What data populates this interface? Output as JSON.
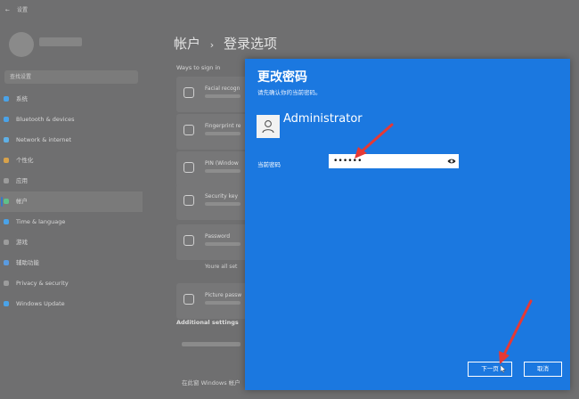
{
  "settings": {
    "topbar": {
      "back": "←",
      "title": "设置"
    },
    "search_placeholder": "查找设置",
    "nav": [
      {
        "label": "系统",
        "color": "#4aa3e8"
      },
      {
        "label": "Bluetooth & devices",
        "color": "#4aa3e8"
      },
      {
        "label": "Network & internet",
        "color": "#5fb0e6"
      },
      {
        "label": "个性化",
        "color": "#d8a24a"
      },
      {
        "label": "应用",
        "color": "#9c9c9c"
      },
      {
        "label": "帐户",
        "color": "#5fc08a"
      },
      {
        "label": "Time & language",
        "color": "#4aa3e8"
      },
      {
        "label": "游戏",
        "color": "#9c9c9c"
      },
      {
        "label": "辅助功能",
        "color": "#5a9be0"
      },
      {
        "label": "Privacy & security",
        "color": "#9c9c9c"
      },
      {
        "label": "Windows Update",
        "color": "#4aa3e8"
      }
    ],
    "active_nav_index": 5,
    "breadcrumb": {
      "parent": "帐户",
      "separator": "›",
      "current": "登录选项"
    },
    "section_label": "Ways to sign in",
    "options": [
      {
        "title": "Facial recogn"
      },
      {
        "title": "Fingerprint re"
      },
      {
        "title": "PIN (Window"
      },
      {
        "title": "Security key"
      },
      {
        "title": "Password"
      },
      {
        "title": "Picture passw"
      }
    ],
    "always_allow": "Youre all set",
    "additional_settings": "Additional settings",
    "bottom_text": "在此窗 Windows 帐户"
  },
  "dialog": {
    "title": "更改密码",
    "subtitle": "请先确认你的当前密码。",
    "username": "Administrator",
    "current_password_label": "当前密码",
    "current_password_value": "••••••",
    "next_label": "下一页",
    "cancel_label": "取消"
  },
  "colors": {
    "dialog_bg": "#1b78e0",
    "overlay": "#6f6f70",
    "arrow": "#e53935"
  }
}
